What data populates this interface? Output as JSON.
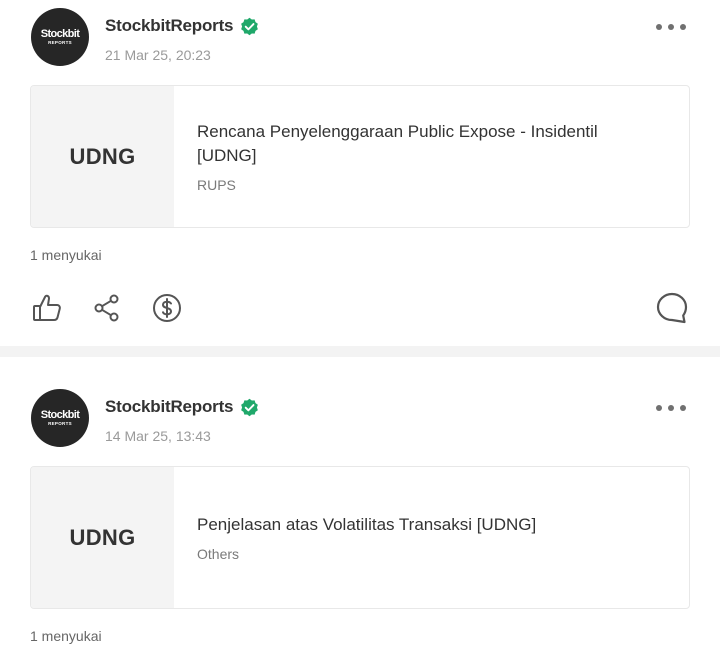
{
  "posts": [
    {
      "author": "StockbitReports",
      "timestamp": "21 Mar 25, 20:23",
      "avatar": {
        "line1": "Stockbit",
        "line2": "REPORTS"
      },
      "card": {
        "ticker": "UDNG",
        "title": "Rencana Penyelenggaraan Public Expose - Insidentil [UDNG]",
        "tag": "RUPS"
      },
      "likes": "1 menyukai"
    },
    {
      "author": "StockbitReports",
      "timestamp": "14 Mar 25, 13:43",
      "avatar": {
        "line1": "Stockbit",
        "line2": "REPORTS"
      },
      "card": {
        "ticker": "UDNG",
        "title": "Penjelasan atas Volatilitas Transaksi [UDNG]",
        "tag": "Others"
      },
      "likes": "1 menyukai"
    }
  ],
  "icons": {
    "verified": "verified-badge-icon",
    "more": "more-horizontal-icon",
    "like": "thumbs-up-icon",
    "share": "share-icon",
    "tip": "dollar-circle-icon",
    "comment": "comment-bubble-icon"
  },
  "colors": {
    "verified": "#1fa86a",
    "icon": "#555555",
    "separator": "#f3f3f3",
    "ticker_bg": "#f4f4f4"
  }
}
